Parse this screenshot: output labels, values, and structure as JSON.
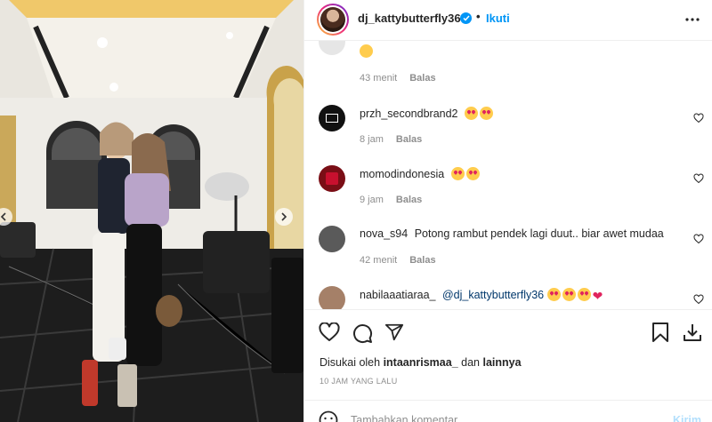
{
  "post": {
    "username": "dj_kattybutterfly36",
    "dot": "•",
    "follow_label": "Ikuti"
  },
  "comments": [
    {
      "username": "",
      "text": "",
      "time": "43 menit",
      "reply": "Balas"
    },
    {
      "username": "przh_secondbrand2",
      "time": "8 jam",
      "reply": "Balas"
    },
    {
      "username": "momodindonesia",
      "time": "9 jam",
      "reply": "Balas"
    },
    {
      "username": "nova_s94",
      "text": "Potong rambut pendek lagi duut.. biar awet mudaa",
      "time": "42 menit",
      "reply": "Balas"
    },
    {
      "username": "nabilaaatiaraa_",
      "mention": "@dj_kattybutterfly36"
    }
  ],
  "likes": {
    "prefix": "Disukai oleh",
    "user": "intaanrismaa_",
    "conj": "dan",
    "others": "lainnya"
  },
  "timestamp": "10 JAM YANG LALU",
  "add_comment": {
    "placeholder": "Tambahkan komentar...",
    "send_label": "Kirim"
  },
  "colors": {
    "accent": "#0095f6",
    "text": "#262626",
    "muted": "#8e8e8e"
  }
}
